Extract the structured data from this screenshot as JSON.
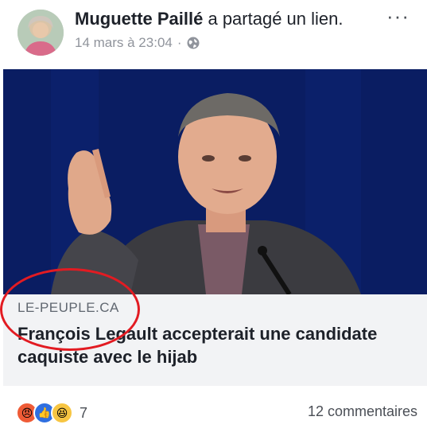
{
  "post": {
    "author_name": "Muguette Paillé",
    "action_text": " a partagé un lien.",
    "timestamp": "14 mars à 23:04",
    "separator": "·",
    "privacy_icon": "globe-icon",
    "more_label": "···"
  },
  "link": {
    "domain": "LE-PEUPLE.CA",
    "title": "François Legault accepterait une candidate caquiste avec le hijab"
  },
  "footer": {
    "reaction_icons": [
      "angry-reaction-icon",
      "like-reaction-icon",
      "haha-reaction-icon"
    ],
    "reaction_count": "7",
    "comments": "12 commentaires"
  },
  "colors": {
    "annotation_circle": "#e21b22",
    "text_primary": "#1d2129",
    "text_secondary": "#90949c",
    "card_background": "#f2f3f5"
  }
}
